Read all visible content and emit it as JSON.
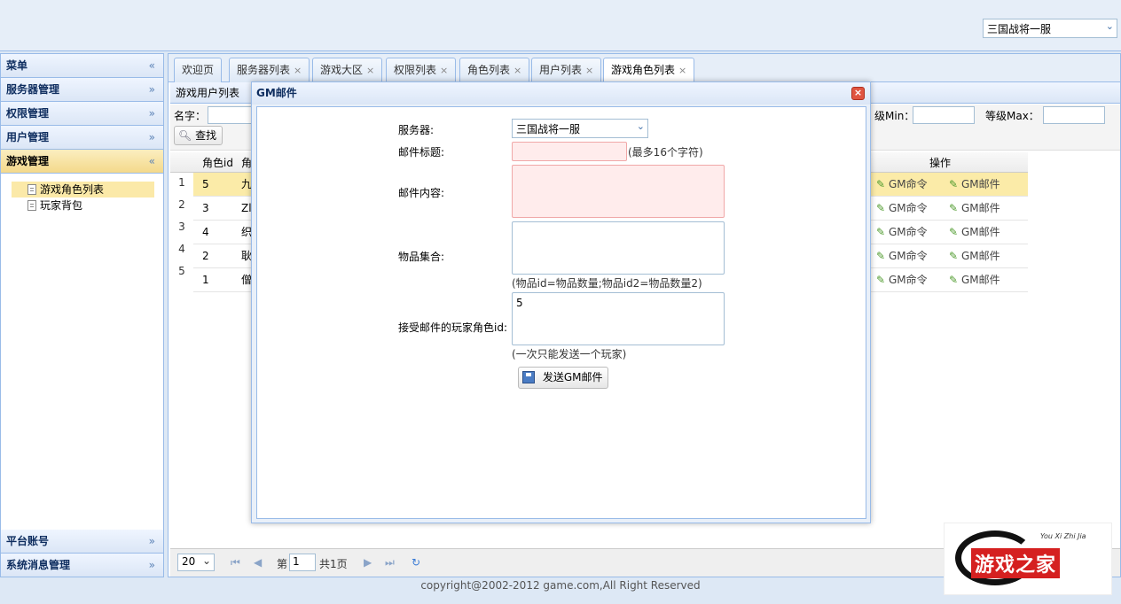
{
  "header": {
    "server_select": "三国战将一服"
  },
  "sidebar": {
    "sections": [
      {
        "label": "菜单",
        "tool": "«"
      },
      {
        "label": "服务器管理",
        "tool": "»"
      },
      {
        "label": "权限管理",
        "tool": "»"
      },
      {
        "label": "用户管理",
        "tool": "»"
      },
      {
        "label": "游戏管理",
        "tool": "«"
      }
    ],
    "items": [
      "游戏角色列表",
      "玩家背包"
    ],
    "bottom_sections": [
      {
        "label": "平台账号",
        "tool": "»"
      },
      {
        "label": "系统消息管理",
        "tool": "»"
      }
    ]
  },
  "tabs": [
    {
      "label": "欢迎页"
    },
    {
      "label": "服务器列表"
    },
    {
      "label": "游戏大区"
    },
    {
      "label": "权限列表"
    },
    {
      "label": "角色列表"
    },
    {
      "label": "用户列表"
    },
    {
      "label": "游戏角色列表"
    }
  ],
  "tab_close": "×",
  "panel": {
    "title": "游戏用户列表",
    "search": {
      "name_label": "名字：",
      "level_min_label": "级Min：",
      "level_max_label": "等级Max：",
      "button": "查找"
    },
    "columns": {
      "role_id": "角色id",
      "name": "角",
      "ops": "操作"
    },
    "rows": [
      {
        "num": "1",
        "id": "5",
        "name": "九"
      },
      {
        "num": "2",
        "id": "3",
        "name": "Zl"
      },
      {
        "num": "3",
        "id": "4",
        "name": "织"
      },
      {
        "num": "4",
        "id": "2",
        "name": "耿"
      },
      {
        "num": "5",
        "id": "1",
        "name": "僧"
      }
    ],
    "op_label": "GM命令",
    "op_label2": "GM邮件"
  },
  "pager": {
    "page_size": "20",
    "page_prefix": "第",
    "page_value": "1",
    "page_total": "共1页"
  },
  "footer": "copyright@2002-2012 game.com,All Right Reserved",
  "logo": {
    "text": "游戏之家",
    "sub": "You Xi Zhi Jia"
  },
  "modal": {
    "title": "GM邮件",
    "close": "×",
    "server_label": "服务器:",
    "server_value": "三国战将一服",
    "subject_label": "邮件标题:",
    "subject_hint": "(最多16个字符)",
    "content_label": "邮件内容:",
    "items_label": "物品集合:",
    "items_hint": "(物品id=物品数量;物品id2=物品数量2)",
    "receiver_label": "接受邮件的玩家角色id:",
    "receiver_value": "5",
    "receiver_hint": "(一次只能发送一个玩家)",
    "send_button": "发送GM邮件"
  }
}
